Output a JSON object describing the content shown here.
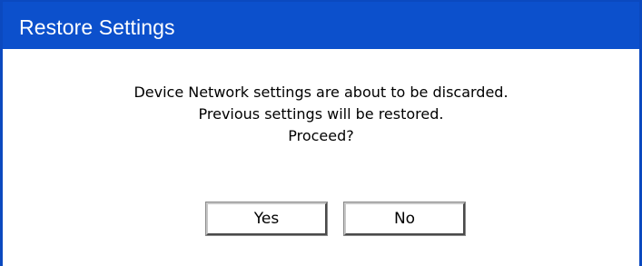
{
  "dialog": {
    "title": "Restore Settings",
    "message_lines": [
      "Device Network settings are about to be discarded.",
      "Previous settings will be restored.",
      "Proceed?"
    ],
    "buttons": {
      "yes_label": "Yes",
      "no_label": "No"
    }
  },
  "colors": {
    "title_bar": "#0c50cc",
    "border": "#0b49bf",
    "background": "#ffffff"
  }
}
